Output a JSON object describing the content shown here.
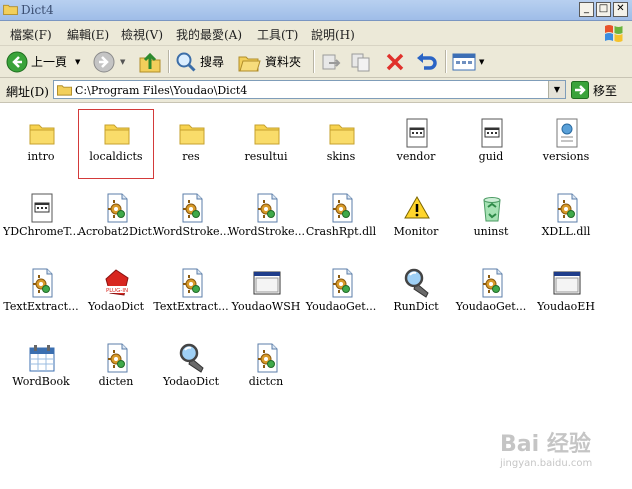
{
  "window": {
    "title": "Dict4"
  },
  "menu": [
    "檔案(F)",
    "編輯(E)",
    "檢視(V)",
    "我的最愛(A)",
    "工具(T)",
    "說明(H)"
  ],
  "toolbar": {
    "back": "上一頁",
    "search": "搜尋",
    "folders": "資料夾"
  },
  "address": {
    "label": "網址(D)",
    "path": "C:\\Program Files\\Youdao\\Dict4",
    "go": "移至"
  },
  "files": [
    {
      "name": "intro",
      "type": "folder"
    },
    {
      "name": "localdicts",
      "type": "folder",
      "selected": true
    },
    {
      "name": "res",
      "type": "folder"
    },
    {
      "name": "resultui",
      "type": "folder"
    },
    {
      "name": "skins",
      "type": "folder"
    },
    {
      "name": "vendor",
      "type": "doc"
    },
    {
      "name": "guid",
      "type": "doc"
    },
    {
      "name": "versions",
      "type": "xml"
    },
    {
      "name": "YDChromeT...",
      "type": "doc"
    },
    {
      "name": "Acrobat2Dict...",
      "type": "dll"
    },
    {
      "name": "WordStroke...",
      "type": "dll"
    },
    {
      "name": "WordStroke...",
      "type": "dll"
    },
    {
      "name": "CrashRpt.dll",
      "type": "dll"
    },
    {
      "name": "Monitor",
      "type": "warning"
    },
    {
      "name": "uninst",
      "type": "recycle"
    },
    {
      "name": "XDLL.dll",
      "type": "dll"
    },
    {
      "name": "TextExtract...",
      "type": "dll"
    },
    {
      "name": "YodaoDict",
      "type": "plugin"
    },
    {
      "name": "TextExtract...",
      "type": "dll"
    },
    {
      "name": "YoudaoWSH",
      "type": "window"
    },
    {
      "name": "YoudaoGet...",
      "type": "dll"
    },
    {
      "name": "RunDict",
      "type": "magnifier"
    },
    {
      "name": "YoudaoGet...",
      "type": "dll"
    },
    {
      "name": "YoudaoEH",
      "type": "window"
    },
    {
      "name": "WordBook",
      "type": "calendar"
    },
    {
      "name": "dicten",
      "type": "dll"
    },
    {
      "name": "YodaoDict",
      "type": "magnifier"
    },
    {
      "name": "dictcn",
      "type": "dll"
    }
  ],
  "watermark": {
    "logo": "Bai 经验",
    "url": "jingyan.baidu.com"
  }
}
